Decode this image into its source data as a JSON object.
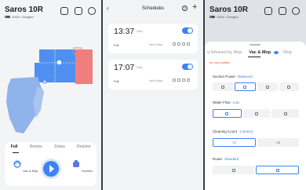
{
  "left": {
    "title": "Saros 10R",
    "battery": "100%",
    "status": "Charged",
    "icons": [
      "video-icon",
      "edit-icon",
      "settings-icon"
    ],
    "tabs": [
      "Full",
      "Rooms",
      "Zones",
      "Routine"
    ],
    "controls": {
      "vac_mop": "Vac & Mop",
      "docked": "Docked"
    },
    "colors": {
      "accent": "#3d83f4",
      "room_blue": "#4f8ff0",
      "room_red": "#f07e7e"
    }
  },
  "middle": {
    "title": "Schedules",
    "schedules": [
      {
        "time": "13:37",
        "day": "Daily",
        "mode": "Full",
        "type": "Vac & Mop",
        "enabled": true
      },
      {
        "time": "17:07",
        "day": "Daily",
        "mode": "Full",
        "type": "Vac & Mop",
        "enabled": true
      }
    ]
  },
  "right": {
    "title": "Saros 10R",
    "battery": "100%",
    "status": "Charged",
    "tabs": [
      "q followed by Mop",
      "Vac & Mop",
      "Mop"
    ],
    "warning": "No mop installed",
    "suction": {
      "label": "Suction Power",
      "value": "Balanced"
    },
    "water": {
      "label": "Water Flow",
      "value": "Low"
    },
    "count": {
      "label": "Cleaning Count",
      "value": "1 time(s)",
      "options": [
        "×1",
        "×2"
      ]
    },
    "route": {
      "label": "Route",
      "value": "Standard"
    }
  }
}
